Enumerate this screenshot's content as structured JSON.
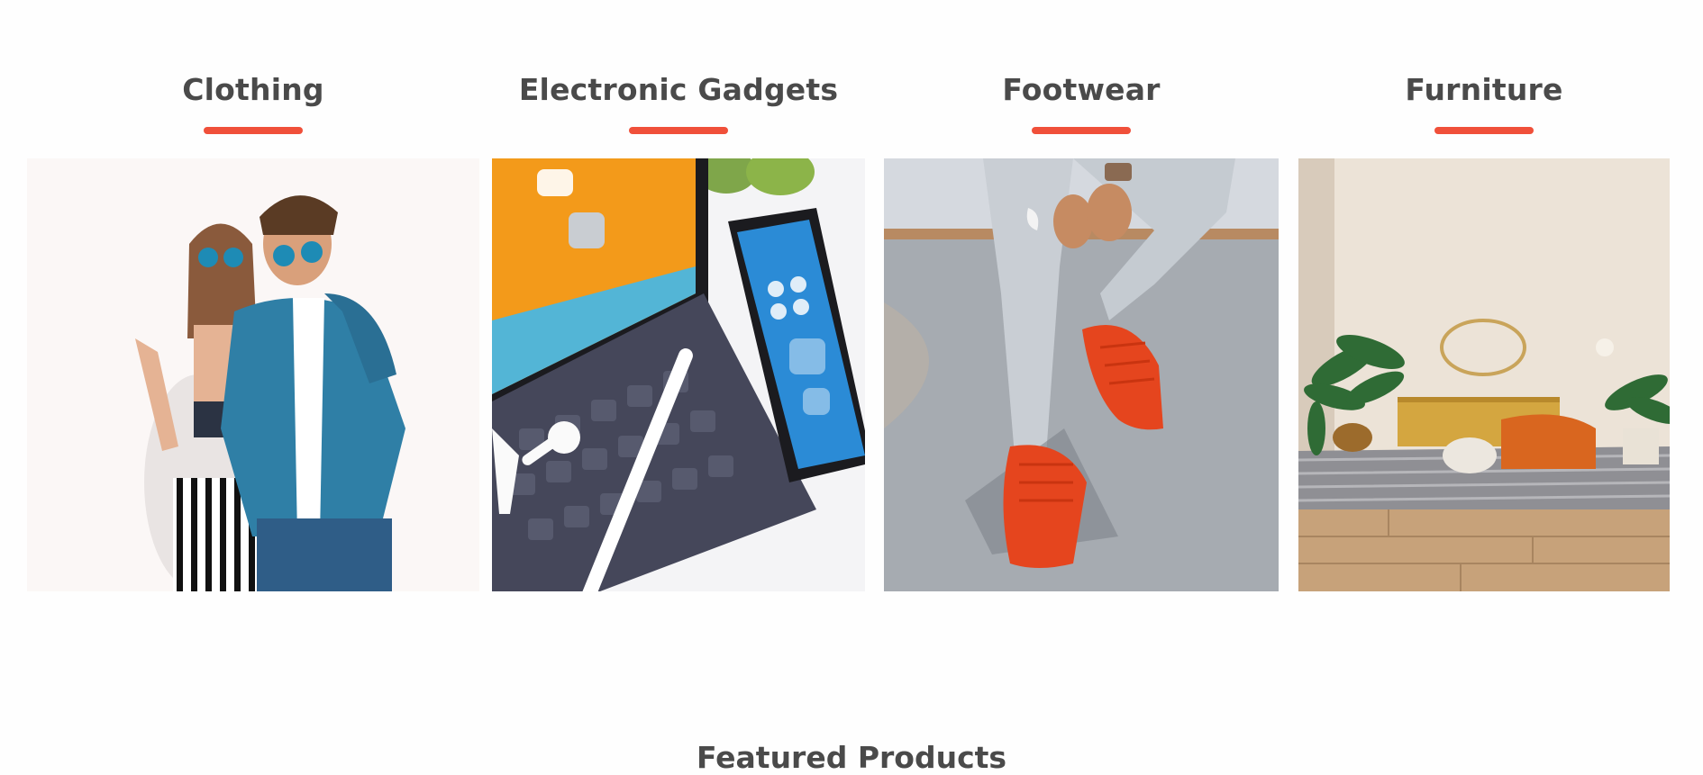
{
  "categories": [
    {
      "title": "Clothing",
      "image": "couple-in-denim-and-sunglasses"
    },
    {
      "title": "Electronic Gadgets",
      "image": "tablet-keyboard-phone-earbuds"
    },
    {
      "title": "Footwear",
      "image": "red-sneakers-on-concrete"
    },
    {
      "title": "Furniture",
      "image": "living-room-with-plants-and-orange-chair"
    }
  ],
  "featured": {
    "title": "Featured Products"
  },
  "colors": {
    "accent": "#f0503a",
    "heading": "#4a4a4a",
    "background": "#fefefe"
  }
}
